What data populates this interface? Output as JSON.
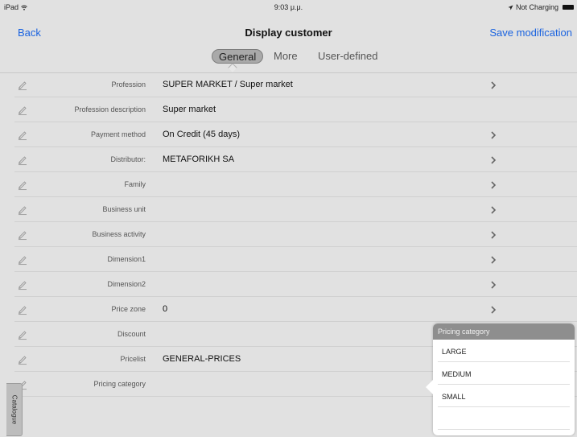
{
  "status_bar": {
    "device": "iPad",
    "time": "9:03 μ.μ.",
    "charging": "Not Charging"
  },
  "nav": {
    "back": "Back",
    "title": "Display customer",
    "save": "Save modification"
  },
  "tabs": [
    {
      "label": "General"
    },
    {
      "label": "More"
    },
    {
      "label": "User-defined"
    }
  ],
  "rows": [
    {
      "label": "Profession",
      "value": "SUPER MARKET / Super market"
    },
    {
      "label": "Profession description",
      "value": "Super market"
    },
    {
      "label": "Payment method",
      "value": "On Credit (45 days)"
    },
    {
      "label": "Distributor:",
      "value": "METAFORIKH SA"
    },
    {
      "label": "Family",
      "value": ""
    },
    {
      "label": "Business unit",
      "value": ""
    },
    {
      "label": "Business activity",
      "value": ""
    },
    {
      "label": "Dimension1",
      "value": ""
    },
    {
      "label": "Dimension2",
      "value": ""
    },
    {
      "label": "Price zone",
      "value": "0"
    },
    {
      "label": "Discount",
      "value": ""
    },
    {
      "label": "Pricelist",
      "value": "GENERAL-PRICES"
    },
    {
      "label": "Pricing category",
      "value": ""
    }
  ],
  "side_tab": "Catalogue",
  "popover": {
    "title": "Pricing category",
    "items": [
      "LARGE",
      "MEDIUM",
      "SMALL",
      ""
    ]
  },
  "colors": {
    "accent": "#1a63e0",
    "background": "#e1e1e1"
  }
}
